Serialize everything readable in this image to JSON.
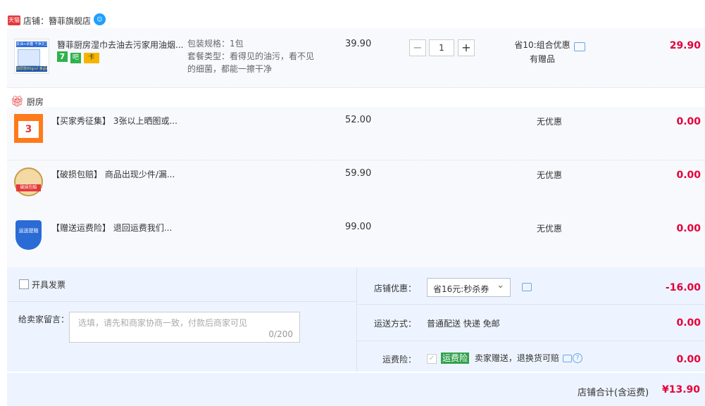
{
  "store": {
    "badge": "天猫",
    "label": "店铺：",
    "name": "簪菲旗舰店"
  },
  "items": [
    {
      "title": "簪菲厨房湿巾去油去污家用油烟...",
      "sku_lines": [
        "包装规格：1包",
        "套餐类型：看得见的油污，看不见",
        "的细菌，都能一擦干净"
      ],
      "unit_price": "39.90",
      "quantity": "1",
      "promo_line1": "省10:组合优惠",
      "promo_line2": "有赠品",
      "subtotal": "29.90",
      "thumb_caption": "去油+杀菌 干净又卫生",
      "thumb_caption2": "加厚款60g/㎡ 食品级",
      "badges": [
        "7",
        "吧",
        "卡"
      ]
    }
  ],
  "gift_section": {
    "label": "厨房"
  },
  "gifts": [
    {
      "thumb_text": "3",
      "title": "【买家秀征集】 3张以上晒图或...",
      "unit_price": "52.00",
      "promo": "无优惠",
      "subtotal": "0.00"
    },
    {
      "thumb_text": "破损包赔",
      "title": "【破损包赔】 商品出现少件/漏...",
      "unit_price": "59.90",
      "promo": "无优惠",
      "subtotal": "0.00"
    },
    {
      "thumb_text": "运送提赔",
      "title": "【赠送运费险】 退回运费我们...",
      "unit_price": "99.00",
      "promo": "无优惠",
      "subtotal": "0.00"
    }
  ],
  "invoice": {
    "label": "开具发票"
  },
  "message": {
    "label": "给卖家留言：",
    "placeholder": "选填，请先和商家协商一致，付款后商家可见",
    "counter": "0/200"
  },
  "store_discount": {
    "label": "店铺优惠：",
    "selected": "省16元:秒杀券",
    "amount": "-16.00"
  },
  "shipping": {
    "label": "运送方式：",
    "value": "普通配送 快递 免邮",
    "amount": "0.00"
  },
  "insurance": {
    "label": "运费险：",
    "tag": "运费险",
    "value": "卖家赠送，退换货可赔",
    "amount": "0.00"
  },
  "total": {
    "label": "店铺合计(含运费)",
    "amount": "¥13.90"
  },
  "colors": {
    "price_red": "#e4003a",
    "panel_blue": "#eef4ff",
    "tmall_red": "#e4393c",
    "insurance_green": "#31a24c"
  }
}
